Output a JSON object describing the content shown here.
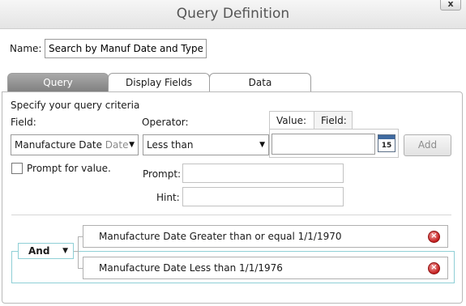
{
  "window": {
    "title": "Query Definition",
    "close": "x"
  },
  "name": {
    "label": "Name:",
    "value": "Search by Manuf Date and Type"
  },
  "tabs": [
    {
      "label": "Query",
      "active": true
    },
    {
      "label": "Display Fields",
      "active": false
    },
    {
      "label": "Data",
      "active": false
    }
  ],
  "query": {
    "instructions": "Specify your query criteria",
    "field_label": "Field:",
    "field_value": "Manufacture Date",
    "field_type": "Date",
    "operator_label": "Operator:",
    "operator_value": "Less than",
    "value_tabs": [
      "Value:",
      "Field:"
    ],
    "value_value": "",
    "calendar_day": "15",
    "add_label": "Add",
    "prompt_checkbox_label": "Prompt for value.",
    "prompt_label": "Prompt:",
    "hint_label": "Hint:"
  },
  "criteria": {
    "group_operator": "And",
    "conditions": [
      "Manufacture Date Greater than or equal 1/1/1970",
      "Manufacture Date Less than 1/1/1976"
    ]
  }
}
